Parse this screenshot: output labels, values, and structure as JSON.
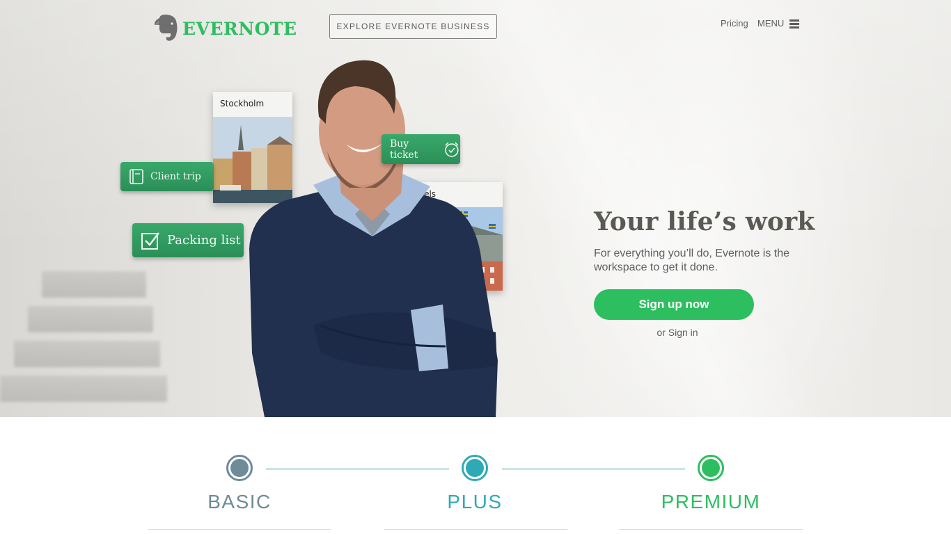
{
  "header": {
    "logo_text": "EVERNOTE",
    "business_button": "EXPLORE EVERNOTE BUSINESS",
    "pricing_link": "Pricing",
    "menu_label": "MENU"
  },
  "hero": {
    "title": "Your life’s work",
    "subtitle": "For everything you’ll do, Evernote is the workspace to get it done.",
    "signup_button": "Sign up now",
    "signin_prefix": "or ",
    "signin_link": "Sign in",
    "notes": {
      "client_trip": "Client trip",
      "packing_list": "Packing list",
      "buy_ticket": "Buy ticket",
      "stockholm": "Stockholm",
      "hotels": "Hotels"
    }
  },
  "plans": [
    {
      "name": "BASIC",
      "color": "#6f8a98"
    },
    {
      "name": "PLUS",
      "color": "#2eaab6"
    },
    {
      "name": "PREMIUM",
      "color": "#2dbe60"
    }
  ],
  "colors": {
    "brand_green": "#2dbe60",
    "text_gray": "#5f5f5f"
  }
}
